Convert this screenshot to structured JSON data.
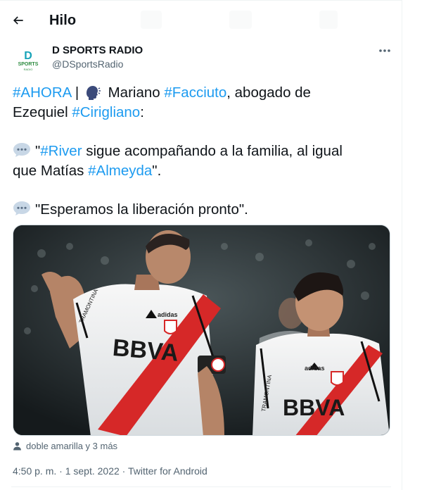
{
  "header": {
    "title": "Hilo"
  },
  "author": {
    "display_name": "D SPORTS RADIO",
    "handle": "@DSportsRadio",
    "avatar_letter": "D",
    "avatar_brand": "SPORTS",
    "avatar_subbrand": "RADIO"
  },
  "tweet": {
    "line1": {
      "tag_ahora": "#AHORA",
      "bar": " |",
      "mariano": " Mariano ",
      "tag_facciuto": "#Facciuto",
      "abogado": ", abogado de"
    },
    "line2": {
      "ezequiel": "Ezequiel ",
      "tag_cirigliano": "#Cirigliano",
      "colon": ":"
    },
    "quote1": {
      "open": "\"",
      "tag_river": "#River",
      "rest": " sigue acompañando a la familia, al igual"
    },
    "quote1b": {
      "start": "que Matías ",
      "tag_almeyda": "#Almeyda",
      "end": "\"."
    },
    "quote2": {
      "text": "\"Esperamos la liberación pronto\"."
    }
  },
  "tagged": {
    "text": "doble amarilla y 3 más"
  },
  "meta": {
    "time": "4:50 p. m.",
    "dot": " · ",
    "date": "1 sept. 2022",
    "dot2": " · ",
    "source": "Twitter for Android"
  },
  "photo": {
    "jersey_sponsor_left": "BBVA",
    "jersey_sponsor_right": "BBVA",
    "jersey_brand": "adidas",
    "jersey_sleeve": "TRAMONTINA"
  },
  "colors": {
    "link": "#1d9bf0",
    "secondary_text": "#536471",
    "river_red": "#d62828",
    "avatar_accent": "#17a3b8"
  },
  "icons": [
    "back-arrow-icon",
    "more-icon",
    "speaking-head-icon",
    "speech-bubble-icon",
    "person-icon"
  ]
}
